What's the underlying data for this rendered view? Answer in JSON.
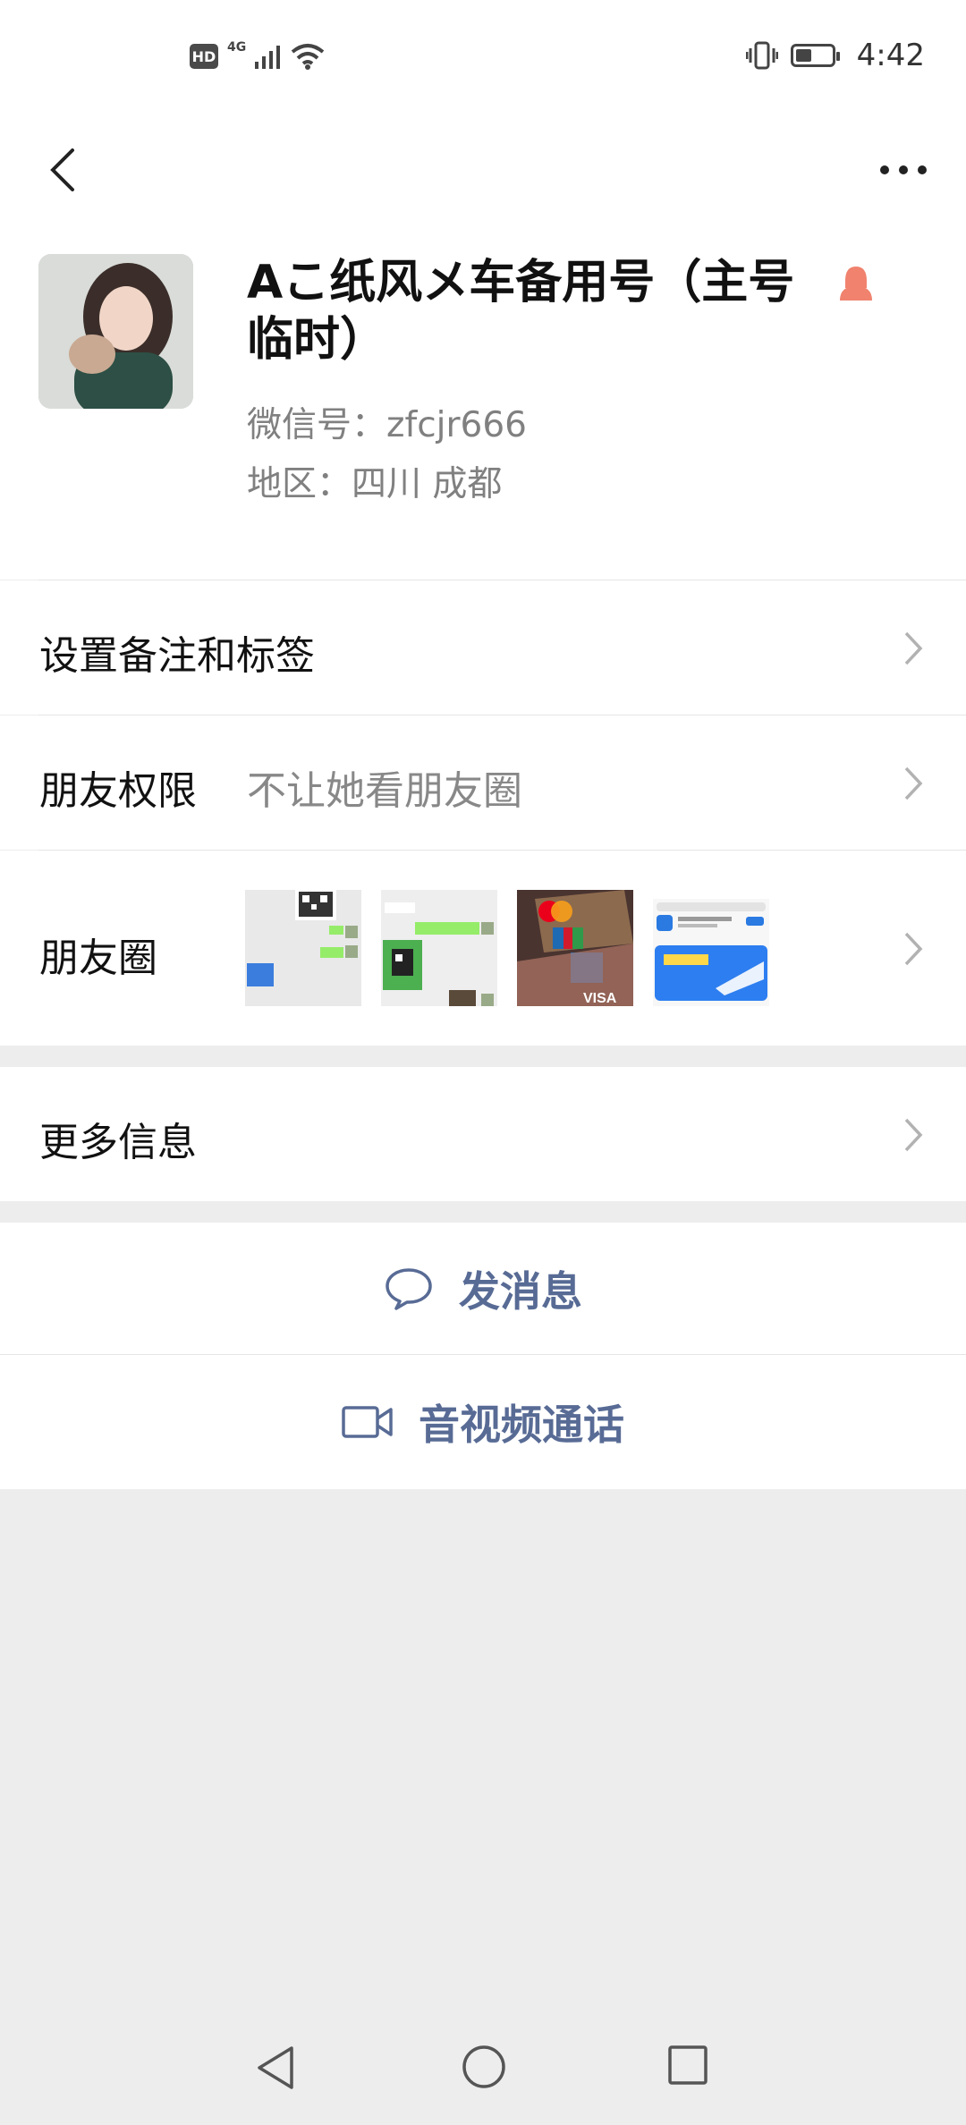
{
  "status_bar": {
    "hd": "HD",
    "network": "4G",
    "time": "4:42",
    "battery_level": 0.45
  },
  "nav": {
    "back_icon": "chevron-left-icon",
    "more_icon": "more-dots-icon"
  },
  "profile": {
    "name": "Aこ纸风メ车备用号（主号临时）",
    "wechat_id": "微信号：zfcjr666",
    "region": "地区：四川  成都",
    "gender_icon": "female-icon",
    "gender_color": "#f0826e"
  },
  "rows": {
    "remark": {
      "label": "设置备注和标签"
    },
    "permission": {
      "label": "朋友权限",
      "value": "不让她看朋友圈"
    },
    "moments": {
      "label": "朋友圈",
      "thumbnails": [
        "chat-qr-screenshot",
        "chat-screenshot",
        "bank-cards-photo",
        "train-app-screenshot"
      ]
    },
    "more_info": {
      "label": "更多信息"
    }
  },
  "actions": {
    "message": {
      "label": "发消息",
      "icon": "chat-bubble-icon"
    },
    "call": {
      "label": "音视频通话",
      "icon": "video-camera-icon"
    }
  },
  "colors": {
    "accent": "#586b95",
    "background": "#ededed"
  }
}
